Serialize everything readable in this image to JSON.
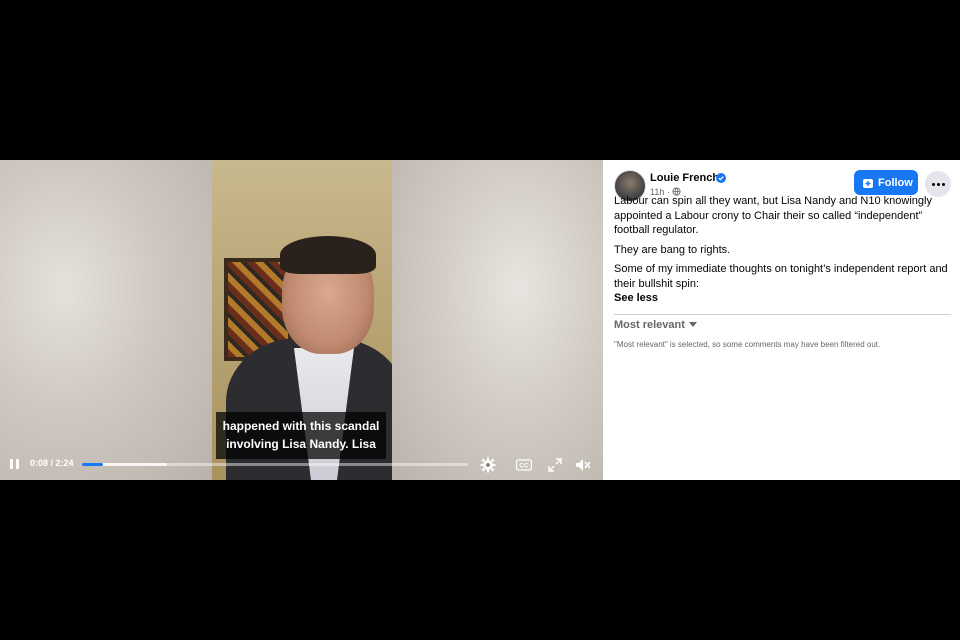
{
  "video": {
    "caption_lines": [
      "happened with this scandal",
      "involving Lisa Nandy. Lisa"
    ],
    "time": "0:08 / 2:24",
    "progress": {
      "played": 0.055,
      "buffered": 0.22
    },
    "controls": {
      "play_pause": "pause-icon",
      "settings": "gear-icon",
      "captions": "cc-icon",
      "fullscreen": "fullscreen-icon",
      "volume": "mute-icon"
    }
  },
  "post": {
    "author": "Louie French",
    "timestamp": "11h",
    "privacy_icon": "globe-icon",
    "follow_label": "Follow",
    "paragraphs": [
      "Labour can spin all they want, but Lisa Nandy and N10 knowingly appointed a Labour crony to Chair their so called “independent” football regulator.",
      "They are bang to rights.",
      "Some of my immediate thoughts on tonight’s independent report and their bullshit spin:"
    ],
    "see_less": "See less"
  },
  "comments": {
    "sort_label": "Most relevant",
    "filter_note": "\"Most relevant\" is selected, so some comments may have been filtered out."
  },
  "colors": {
    "accent": "#1877f2",
    "panel_bg": "#ffffff",
    "page_bg": "#000000"
  }
}
